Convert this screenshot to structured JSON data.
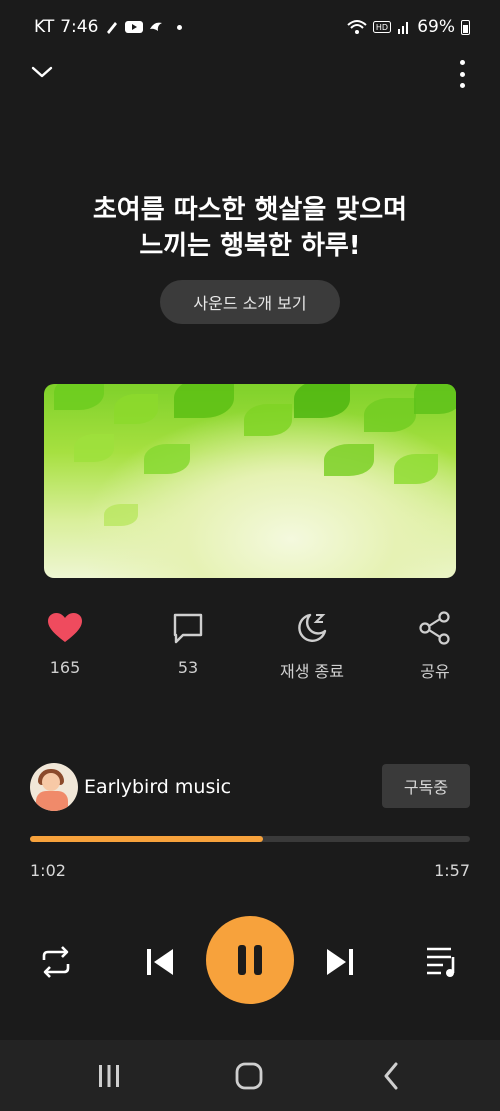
{
  "status_bar": {
    "carrier": "KT",
    "time": "7:46",
    "battery": "69%",
    "icons": [
      "pen-icon",
      "youtube-icon",
      "bird-icon",
      "dot-icon",
      "wifi-icon",
      "hd-icon",
      "signal-icon",
      "battery-icon"
    ]
  },
  "top_bar": {
    "collapse_icon": "chevron-down-icon",
    "menu_icon": "more-vertical-icon"
  },
  "track": {
    "title_line1": "초여름 따스한 햇살을 맞으며",
    "title_line2": "느끼는 행복한 하루!",
    "intro_button": "사운드 소개 보기"
  },
  "actions": {
    "like": {
      "icon": "heart-icon",
      "label": "165",
      "color": "#ef4b5e"
    },
    "comment": {
      "icon": "comment-icon",
      "label": "53"
    },
    "sleep": {
      "icon": "moon-zzz-icon",
      "label": "재생 종료"
    },
    "share": {
      "icon": "share-icon",
      "label": "공유"
    }
  },
  "channel": {
    "name": "Earlybird music",
    "subscribe_label": "구독중"
  },
  "player": {
    "current_time": "1:02",
    "total_time": "1:57",
    "progress": 0.53,
    "accent_color": "#f7a23c",
    "controls": [
      "repeat-icon",
      "previous-icon",
      "pause-icon",
      "next-icon",
      "playlist-icon"
    ]
  },
  "nav_bar": {
    "items": [
      "recent-apps-icon",
      "home-icon",
      "back-icon"
    ]
  }
}
